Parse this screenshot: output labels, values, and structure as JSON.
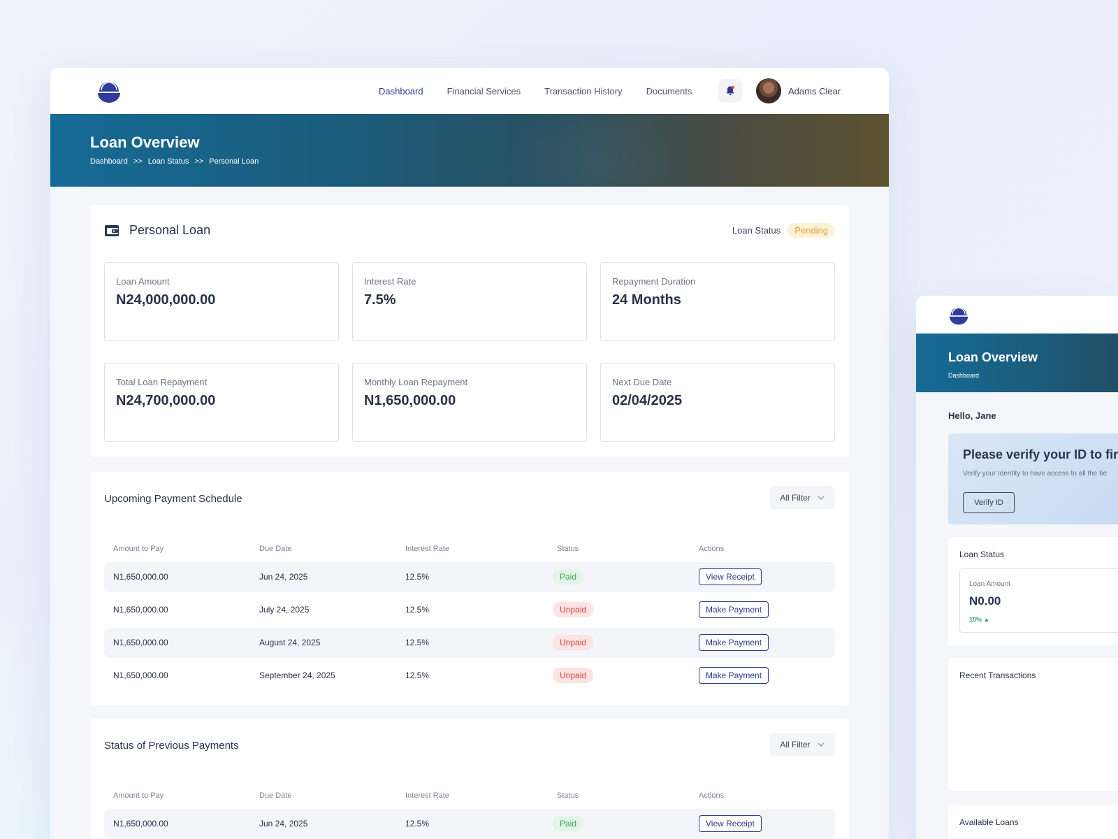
{
  "nav": {
    "items": [
      {
        "label": "Dashboard",
        "active": true
      },
      {
        "label": "Financial Services",
        "active": false
      },
      {
        "label": "Transaction History",
        "active": false
      },
      {
        "label": "Documents",
        "active": false
      }
    ],
    "user_name": "Adams Clear"
  },
  "hero": {
    "title": "Loan Overview",
    "breadcrumb": [
      "Dashboard",
      ">>",
      "Loan Status",
      ">>",
      "Personal Loan"
    ]
  },
  "loan": {
    "title": "Personal Loan",
    "status_label": "Loan Status",
    "status": "Pending",
    "stats": [
      {
        "label": "Loan Amount",
        "value": "N24,000,000.00"
      },
      {
        "label": "Interest Rate",
        "value": "7.5%"
      },
      {
        "label": "Repayment Duration",
        "value": "24 Months"
      },
      {
        "label": "Total Loan Repayment",
        "value": "N24,700,000.00"
      },
      {
        "label": "Monthly Loan Repayment",
        "value": "N1,650,000.00"
      },
      {
        "label": "Next Due Date",
        "value": "02/04/2025"
      }
    ]
  },
  "schedule": {
    "title": "Upcoming Payment Schedule",
    "filter": "All Filter",
    "columns": [
      "Amount to Pay",
      "Due Date",
      "Interest Rate",
      "Status",
      "Actions"
    ],
    "rows": [
      {
        "amount": "N1,650,000.00",
        "date": "Jun 24, 2025",
        "rate": "12.5%",
        "status": "Paid",
        "action": "View Receipt"
      },
      {
        "amount": "N1,650,000.00",
        "date": "July 24, 2025",
        "rate": "12.5%",
        "status": "Unpaid",
        "action": "Make Payment"
      },
      {
        "amount": "N1,650,000.00",
        "date": "August 24, 2025",
        "rate": "12.5%",
        "status": "Unpaid",
        "action": "Make Payment"
      },
      {
        "amount": "N1,650,000.00",
        "date": "September 24, 2025",
        "rate": "12.5%",
        "status": "Unpaid",
        "action": "Make Payment"
      }
    ]
  },
  "previous": {
    "title": "Status of Previous Payments",
    "filter": "All Filter",
    "columns": [
      "Amount to Pay",
      "Due Date",
      "Interest Rate",
      "Status",
      "Actions"
    ],
    "rows": [
      {
        "amount": "N1,650,000.00",
        "date": "Jun 24, 2025",
        "rate": "12.5%",
        "status": "Paid",
        "action": "View Receipt"
      }
    ]
  },
  "side": {
    "hero_title": "Loan Overview",
    "hero_crumb": "Dashboard",
    "greeting": "Hello, Jane",
    "verify_title": "Please verify your ID to fir",
    "verify_sub": "Verify your Identity to have access to all the be",
    "verify_button": "Verify ID",
    "loan_status_title": "Loan Status",
    "loan_amount_label": "Loan Amount",
    "loan_amount_value": "N0.00",
    "trend": "10%",
    "recent_title": "Recent Transactions",
    "available_title": "Available Loans"
  },
  "colors": {
    "accent": "#2a3a8a",
    "pending": "#e0a33a",
    "paid": "#3aa55a",
    "unpaid": "#d6453f"
  }
}
